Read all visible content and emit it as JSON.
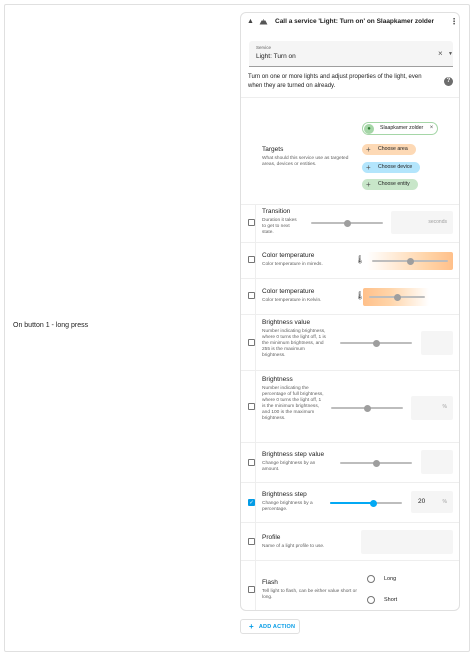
{
  "trigger": {
    "label": "On button 1 - long press"
  },
  "action": {
    "title": "Call a service 'Light: Turn on' on Slaapkamer zolder",
    "service_field_label": "Service",
    "service_value": "Light: Turn on",
    "description": "Turn on one or more lights and adjust properties of the light, even when they are turned on already."
  },
  "targets": {
    "title": "Targets",
    "description": "What should this service use as targeted areas, devices or entities.",
    "selected": "Slaapkamer zolder",
    "choose_area": "Choose area",
    "choose_device": "Choose device",
    "choose_entity": "Choose entity"
  },
  "fields": {
    "transition": {
      "title": "Transition",
      "description": "Duration it takes to get to next state.",
      "suffix": "seconds",
      "slider_fraction": 0.5
    },
    "color_temp_mireds": {
      "title": "Color temperature",
      "description": "Color temperature in mireds.",
      "slider_fraction": 0.5
    },
    "color_temp_kelvin": {
      "title": "Color temperature",
      "description": "Color temperature in Kelvin.",
      "slider_fraction": 0.5
    },
    "brightness_value": {
      "title": "Brightness value",
      "description": "Number indicating brightness, where 0 turns the light off, 1 is the minimum brightness, and 255 is the maximum brightness.",
      "slider_fraction": 0.5
    },
    "brightness": {
      "title": "Brightness",
      "description": "Number indicating the percentage of full brightness, where 0 turns the light off, 1 is the minimum brightness, and 100 is the maximum brightness.",
      "suffix": "%",
      "slider_fraction": 0.5
    },
    "brightness_step_value": {
      "title": "Brightness step value",
      "description": "Change brightness by an amount.",
      "slider_fraction": 0.5
    },
    "brightness_step": {
      "title": "Brightness step",
      "description": "Change brightness by a percentage.",
      "value": "20",
      "suffix": "%",
      "slider_fraction": 0.6,
      "checked": true
    },
    "profile": {
      "title": "Profile",
      "description": "Name of a light profile to use."
    },
    "flash": {
      "title": "Flash",
      "description": "Tell light to flash, can be either value short or long.",
      "options": [
        "Long",
        "Short"
      ]
    }
  },
  "add_action_label": "ADD ACTION",
  "colors": {
    "accent": "#03a9f4",
    "checked": "#039be5",
    "area_chip": "#fdd9b5",
    "device_chip": "#b3e5fc",
    "entity_chip": "#c8e6c9"
  }
}
